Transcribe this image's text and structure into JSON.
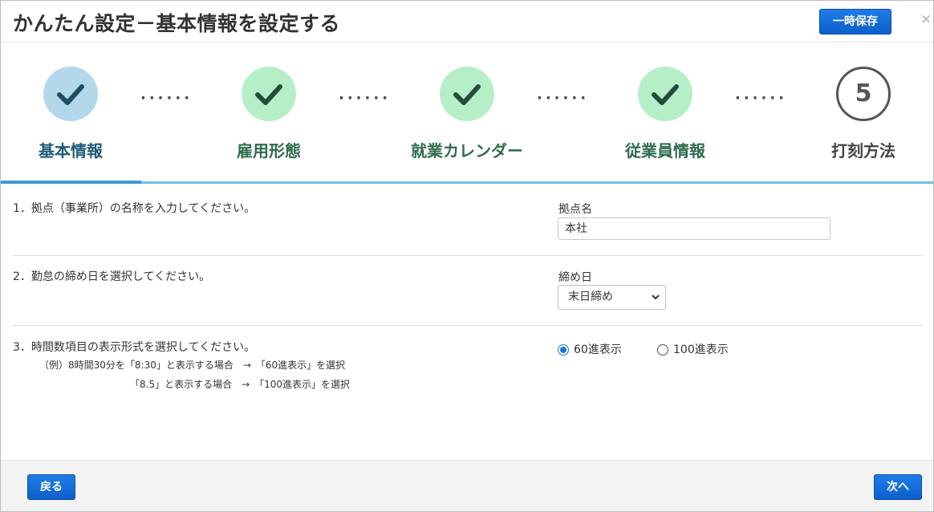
{
  "header": {
    "title": "かんたん設定－基本情報を設定する",
    "save_label": "一時保存",
    "close_glyph": "×"
  },
  "steps": [
    {
      "label": "基本情報",
      "state": "active"
    },
    {
      "label": "雇用形態",
      "state": "done"
    },
    {
      "label": "就業カレンダー",
      "state": "done"
    },
    {
      "label": "従業員情報",
      "state": "done"
    },
    {
      "label": "打刻方法",
      "state": "todo",
      "number": "5"
    }
  ],
  "step_dots": "······",
  "form": {
    "q1": {
      "question": "1．拠点（事業所）の名称を入力してください。",
      "field_label": "拠点名",
      "value": "本社"
    },
    "q2": {
      "question": "2．勤怠の締め日を選択してください。",
      "field_label": "締め日",
      "selected": "末日締め"
    },
    "q3": {
      "question": "3．時間数項目の表示形式を選択してください。",
      "example_line1": "（例）8時間30分を「8:30」と表示する場合　→　「60進表示」を選択",
      "example_line2": "「8.5」と表示する場合　→　「100進表示」を選択",
      "options": [
        {
          "label": "60進表示",
          "checked": true
        },
        {
          "label": "100進表示",
          "checked": false
        }
      ]
    }
  },
  "footer": {
    "back_label": "戻る",
    "next_label": "次へ"
  },
  "colors": {
    "primary_button": "#0d5fc9",
    "active_step": "#b3d8ec",
    "done_step": "#b6efc7",
    "tab_bar": "#6fbfe3"
  }
}
